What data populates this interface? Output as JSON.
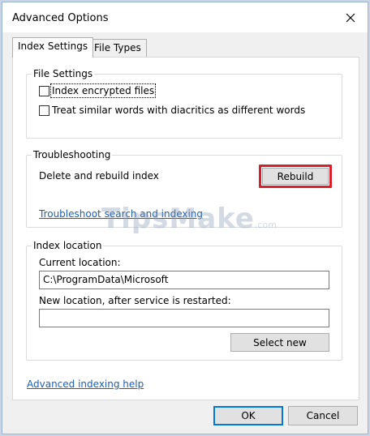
{
  "window": {
    "title": "Advanced Options"
  },
  "tabs": [
    {
      "label": "Index Settings",
      "active": true
    },
    {
      "label": "File Types",
      "active": false
    }
  ],
  "file_settings": {
    "label": "File Settings",
    "options": [
      {
        "label": "Index encrypted files",
        "checked": false
      },
      {
        "label": "Treat similar words with diacritics as different words",
        "checked": false
      }
    ]
  },
  "troubleshooting": {
    "label": "Troubleshooting",
    "description": "Delete and rebuild index",
    "rebuild_label": "Rebuild",
    "link_label": "Troubleshoot search and indexing"
  },
  "index_location": {
    "label": "Index location",
    "current_label": "Current location:",
    "current_value": "C:\\ProgramData\\Microsoft",
    "new_label": "New location, after service is restarted:",
    "new_value": "",
    "select_new_label": "Select new"
  },
  "footer": {
    "help_link": "Advanced indexing help",
    "ok_label": "OK",
    "cancel_label": "Cancel"
  },
  "watermark": {
    "brand": "TipsMake",
    "suffix": ".com"
  },
  "colors": {
    "highlight": "#d81f2a",
    "link": "#1a5fb4",
    "accent": "#0078d7"
  }
}
